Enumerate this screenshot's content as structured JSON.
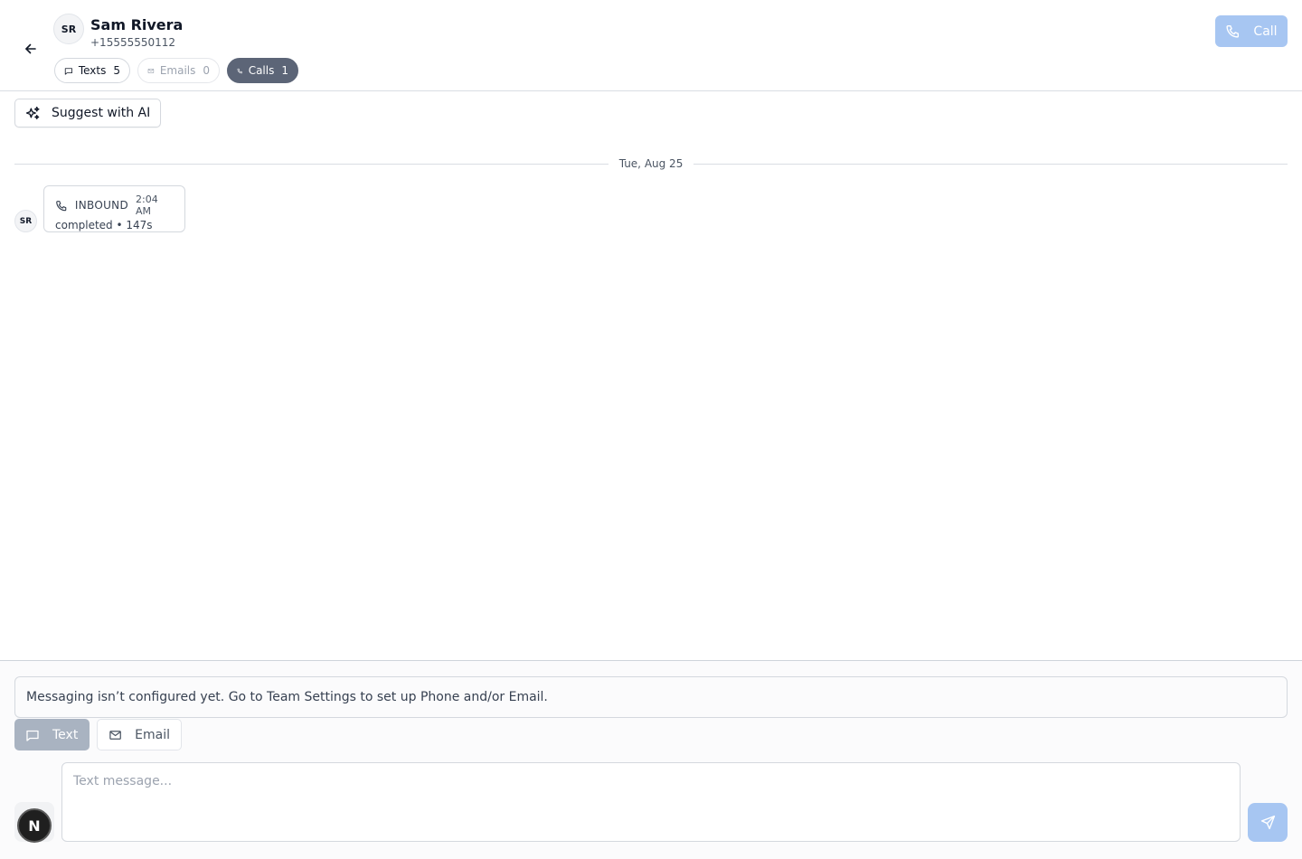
{
  "header": {
    "contact_initials": "SR",
    "contact_name": "Sam Rivera",
    "contact_phone": "+15555550112",
    "call_label": "Call",
    "chips": [
      {
        "label": "Texts",
        "count": "5"
      },
      {
        "label": "Emails",
        "count": "0"
      },
      {
        "label": "Calls",
        "count": "1"
      }
    ]
  },
  "toolbar": {
    "ai_label": "Suggest with AI"
  },
  "thread": {
    "date_label": "Tue, Aug 25",
    "items": [
      {
        "initials": "SR",
        "direction": "INBOUND",
        "time": "2:04 AM",
        "summary": "completed • 147s"
      }
    ]
  },
  "composer": {
    "notice": "Messaging isn’t configured yet. Go to Team Settings to set up Phone and/or Email.",
    "modes": [
      {
        "label": "Text"
      },
      {
        "label": "Email"
      }
    ],
    "placeholder": "Text message...",
    "badge_letter": "N"
  },
  "colors": {
    "accent_disabled": "#a7c6f2",
    "chip_active": "#5c6577",
    "mode_active": "#a9b3c1"
  }
}
